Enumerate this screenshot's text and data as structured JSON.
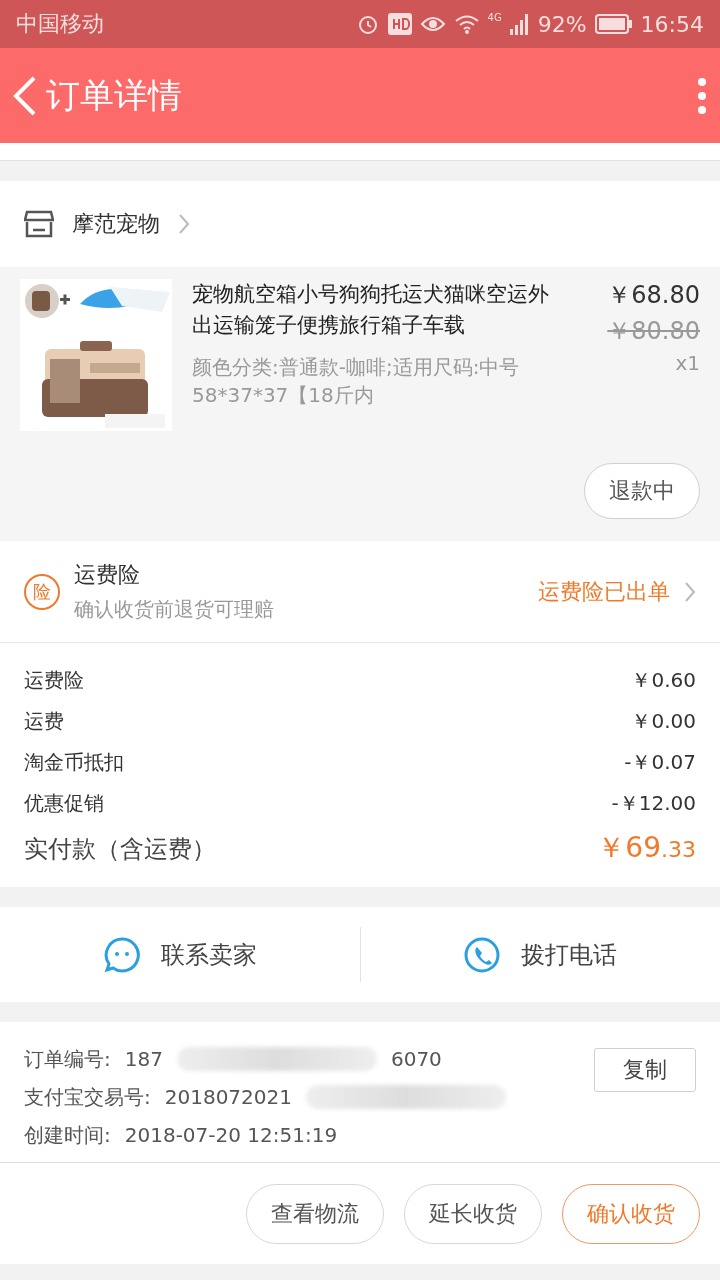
{
  "status_bar": {
    "carrier": "中国移动",
    "network": "4G",
    "battery": "92%",
    "time": "16:54"
  },
  "header": {
    "title": "订单详情"
  },
  "store": {
    "name": "摩范宠物"
  },
  "product": {
    "title": "宠物航空箱小号狗狗托运犬猫咪空运外出运输笼子便携旅行箱子车载",
    "sku": "颜色分类:普通款-咖啡;适用尺码:中号58*37*37【18斤内",
    "price": "￥68.80",
    "original_price": "￥80.80",
    "quantity": "x1",
    "refund_button": "退款中"
  },
  "insurance": {
    "badge": "险",
    "title": "运费险",
    "subtitle": "确认收货前退货可理赔",
    "status": "运费险已出单"
  },
  "fees": [
    {
      "label": "运费险",
      "value": "￥0.60"
    },
    {
      "label": "运费",
      "value": "￥0.00"
    },
    {
      "label": "淘金币抵扣",
      "value": "-￥0.07"
    },
    {
      "label": "优惠促销",
      "value": "-￥12.00"
    }
  ],
  "total": {
    "label": "实付款（含运费）",
    "amount": "￥69",
    "decimals": ".33"
  },
  "contacts": [
    {
      "kind": "chat",
      "label": "联系卖家"
    },
    {
      "kind": "phone",
      "label": "拨打电话"
    }
  ],
  "order_info": {
    "rows": [
      {
        "label": "订单编号:",
        "value_start": "187",
        "value_end": "6070",
        "blurred": true
      },
      {
        "label": "支付宝交易号:",
        "value_start": "2018072021",
        "blurred": true
      },
      {
        "label": "创建时间:",
        "value_start": "2018-07-20 12:51:19",
        "blurred": false
      }
    ],
    "copy_button": "复制"
  },
  "bottom_buttons": [
    {
      "label": "查看物流",
      "kind": "default"
    },
    {
      "label": "延长收货",
      "kind": "default"
    },
    {
      "label": "确认收货",
      "kind": "primary"
    }
  ]
}
